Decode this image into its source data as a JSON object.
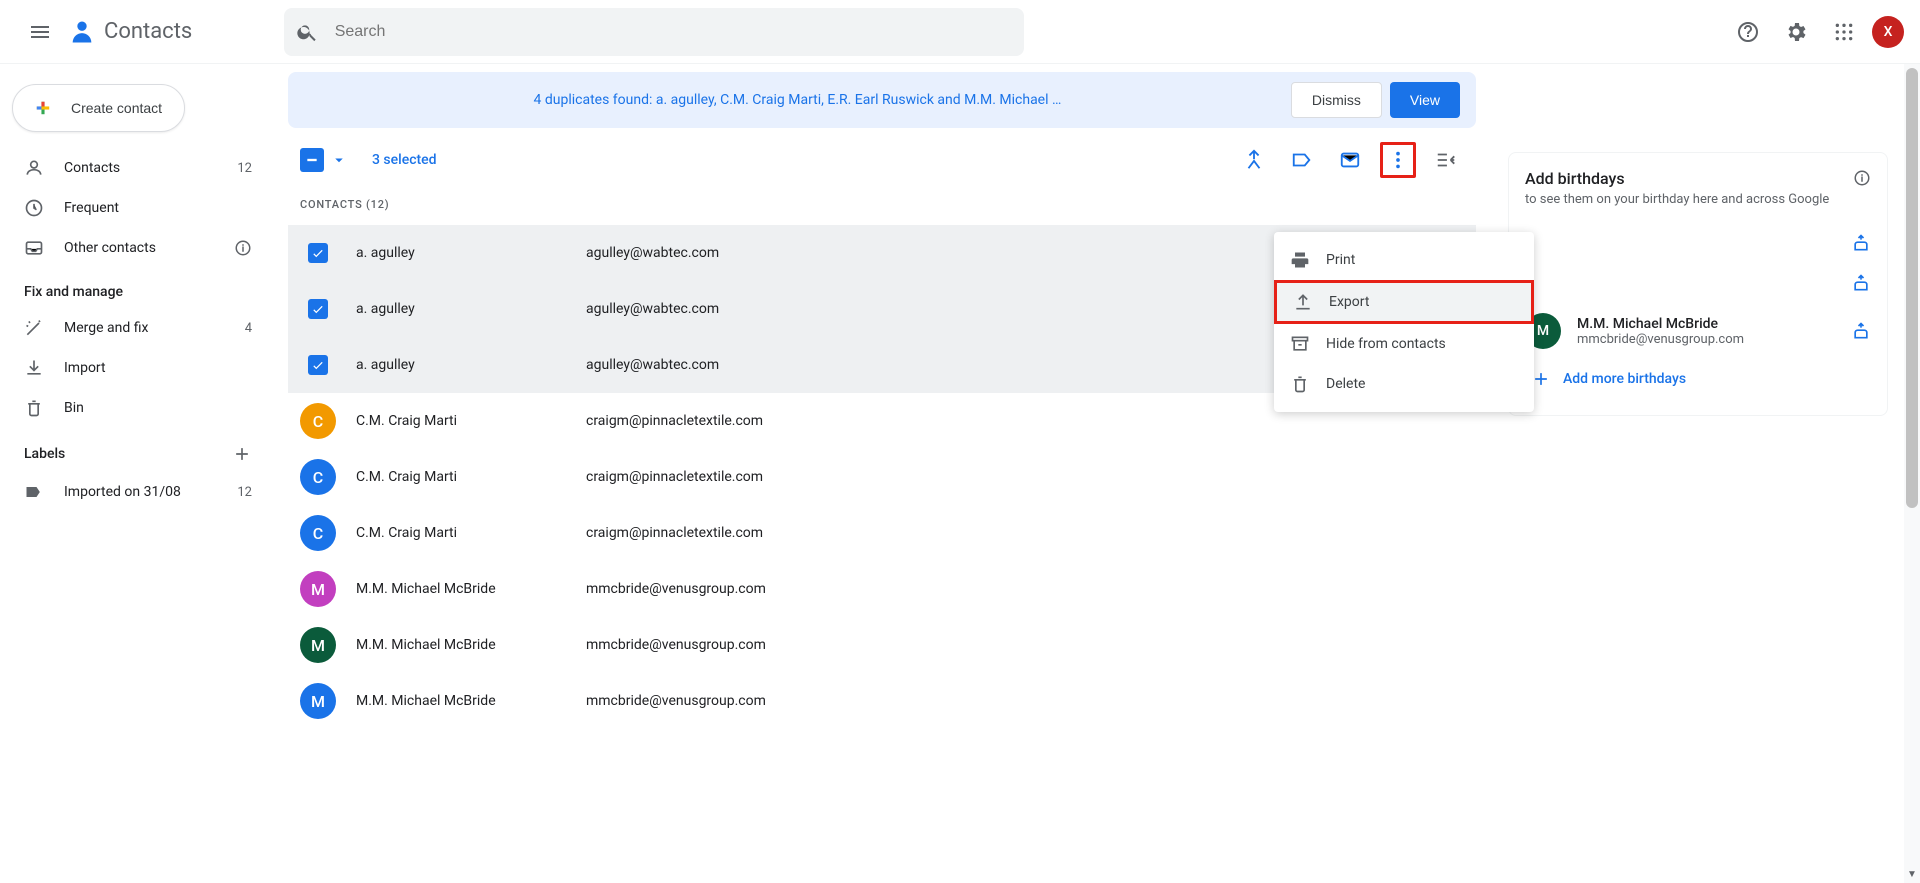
{
  "header": {
    "app_name": "Contacts",
    "search_placeholder": "Search",
    "avatar_letter": "X"
  },
  "sidebar": {
    "create_label": "Create contact",
    "items": [
      {
        "icon": "user",
        "label": "Contacts",
        "count": "12"
      },
      {
        "icon": "clock",
        "label": "Frequent",
        "count": ""
      },
      {
        "icon": "inbox",
        "label": "Other contacts",
        "right_icon": "info"
      }
    ],
    "fix_title": "Fix and manage",
    "manage": [
      {
        "icon": "wand",
        "label": "Merge and fix",
        "count": "4"
      },
      {
        "icon": "download",
        "label": "Import",
        "count": ""
      },
      {
        "icon": "trash",
        "label": "Bin",
        "count": ""
      }
    ],
    "labels_title": "Labels",
    "labels": [
      {
        "icon": "tag",
        "label": "Imported on 31/08",
        "count": "12"
      }
    ]
  },
  "banner": {
    "text": "4 duplicates found: a. agulley, C.M. Craig Marti, E.R. Earl Ruswick and M.M. Michael …",
    "dismiss": "Dismiss",
    "view": "View"
  },
  "toolbar": {
    "selected_text": "3 selected"
  },
  "list_header": "CONTACTS (12)",
  "contacts": [
    {
      "selected": true,
      "avatar": "",
      "avatar_color": "#9aa0a6",
      "name": "a. agulley",
      "email": "agulley@wabtec.com"
    },
    {
      "selected": true,
      "avatar": "",
      "avatar_color": "#9aa0a6",
      "name": "a. agulley",
      "email": "agulley@wabtec.com"
    },
    {
      "selected": true,
      "avatar": "",
      "avatar_color": "#9aa0a6",
      "name": "a. agulley",
      "email": "agulley@wabtec.com"
    },
    {
      "selected": false,
      "avatar": "C",
      "avatar_color": "#f29900",
      "name": "C.M. Craig Marti",
      "email": "craigm@pinnacletextile.com"
    },
    {
      "selected": false,
      "avatar": "C",
      "avatar_color": "#1a73e8",
      "name": "C.M. Craig Marti",
      "email": "craigm@pinnacletextile.com"
    },
    {
      "selected": false,
      "avatar": "C",
      "avatar_color": "#1a73e8",
      "name": "C.M. Craig Marti",
      "email": "craigm@pinnacletextile.com"
    },
    {
      "selected": false,
      "avatar": "M",
      "avatar_color": "#c23fbf",
      "name": "M.M. Michael McBride",
      "email": "mmcbride@venusgroup.com"
    },
    {
      "selected": false,
      "avatar": "M",
      "avatar_color": "#0b5b3b",
      "name": "M.M. Michael McBride",
      "email": "mmcbride@venusgroup.com"
    },
    {
      "selected": false,
      "avatar": "M",
      "avatar_color": "#1a73e8",
      "name": "M.M. Michael McBride",
      "email": "mmcbride@venusgroup.com"
    }
  ],
  "menu": {
    "items": [
      {
        "icon": "print",
        "label": "Print"
      },
      {
        "icon": "export",
        "label": "Export",
        "highlight": true
      },
      {
        "icon": "archive",
        "label": "Hide from contacts"
      },
      {
        "icon": "trash",
        "label": "Delete"
      }
    ]
  },
  "side_card": {
    "title": "Add birthdays",
    "subtitle": "to see them on your birthday here and across Google",
    "rows": [
      {
        "avatar": "M",
        "color": "#0b5b3b",
        "name": "M.M. Michael McBride",
        "email": "mmcbride@venusgroup.com"
      }
    ],
    "add_more_label": "Add more birthdays"
  }
}
